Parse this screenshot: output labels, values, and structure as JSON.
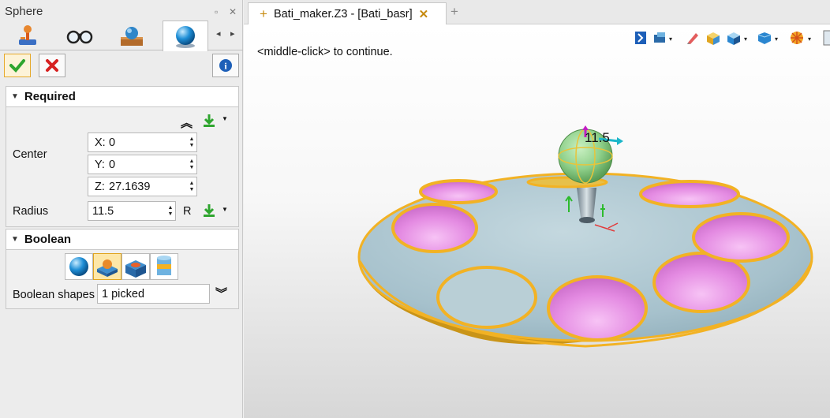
{
  "panel": {
    "title": "Sphere",
    "ok_tooltip": "OK",
    "required": {
      "header": "Required",
      "center_label": "Center",
      "x_axis": "X:",
      "x_value": "0",
      "y_axis": "Y:",
      "y_value": "0",
      "z_axis": "Z:",
      "z_value": "27.1639",
      "radius_label": "Radius",
      "radius_value": "11.5",
      "radius_suffix": "R"
    },
    "boolean": {
      "header": "Boolean",
      "shapes_label": "Boolean shapes",
      "shapes_value": "1 picked"
    }
  },
  "document": {
    "tab_title": "Bati_maker.Z3 - [Bati_basr]",
    "tab_modified_mark": "+",
    "new_tab_symbol": "+"
  },
  "viewport": {
    "message": "<middle-click> to continue.",
    "dimension_label": "11.5"
  },
  "colors": {
    "accent_orange": "#f2b224",
    "plate": "#a9c4cf",
    "pocket": "#e98ee8",
    "sphere": "#8fd08a"
  }
}
